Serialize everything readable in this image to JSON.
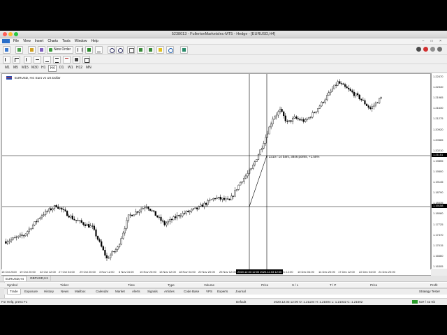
{
  "window": {
    "title": "5238013 - FullertonMarketsInc-MT5 - Hedge - [EURUSD,H4]",
    "controls": "– □ ×"
  },
  "menu": [
    "File",
    "View",
    "Insert",
    "Charts",
    "Tools",
    "Window",
    "Help"
  ],
  "toolbar": {
    "new_order_label": "New Order"
  },
  "timeframes": [
    "M1",
    "M5",
    "M15",
    "M30",
    "H1",
    "H4",
    "D1",
    "W1",
    "MN"
  ],
  "timeframes_extra": [
    "H12"
  ],
  "selected_timeframe": "H4",
  "chart": {
    "symbol_label": "EURUSD, H4:  Euro vs US Dollar",
    "crosshair_info": "T 2310 / 14 bars, 3846 points, +1.55%",
    "crosshair_time_label": "2020.12.03 12:00 2020.12.03 12:00",
    "price_ticks": [
      "1.22470",
      "1.22340",
      "1.21965",
      "1.21630",
      "1.21275",
      "1.20920",
      "1.20565",
      "1.20210",
      "1.19855",
      "1.19500",
      "1.19145",
      "1.18790",
      "1.18435",
      "1.18080",
      "1.17725",
      "1.17370",
      "1.17015",
      "1.16660",
      "1.16305"
    ],
    "crosshair_price_label": "1.21151",
    "second_price_label": "1.19158",
    "time_ticks": [
      "15 Oct 2020",
      "19 Oct 20:00",
      "22 Oct 12:00",
      "27 Oct 04:00",
      "29 Oct 20:00",
      "3 Nov 12:00",
      "6 Nov 04:00",
      "10 Nov 20:00",
      "13 Nov 12:00",
      "18 Nov 04:00",
      "20 Nov 20:00",
      "25 Nov 12:00",
      "7 Dec 12:00",
      "10 Dec 04:00",
      "14 Dec 20:00",
      "17 Dec 12:00",
      "22 Dec 04:00",
      "24 Dec 20:00"
    ],
    "colors": {
      "bull": "#ffffff",
      "bear": "#000000",
      "line": "#000000",
      "background": "#ffffff"
    }
  },
  "chart_tabs": [
    "EURUSD,H4",
    "GBPUSD,H1"
  ],
  "active_chart_tab": "EURUSD,H4",
  "terminal": {
    "columns": [
      "Symbol",
      "Ticket",
      "Time",
      "Type",
      "Volume",
      "Price",
      "S / L",
      "T / P",
      "Price",
      "Profit"
    ],
    "tabs": [
      "Trade",
      "Exposure",
      "History",
      "News",
      "Mailbox",
      "Calendar",
      "Market",
      "Alerts",
      "Signals",
      "Articles",
      "Code Base",
      "VPS",
      "Experts",
      "Journal"
    ],
    "active_tab": "Trade",
    "strategy_tester": "Strategy Tester"
  },
  "status": {
    "help": "For Help, press F1",
    "profile": "Default",
    "ohlc": "2020.12.03 12:00    O: 1.21104    H: 1.21604    L: 1.21032    C: 1.21502",
    "traffic": "637 / 42 Kb"
  }
}
